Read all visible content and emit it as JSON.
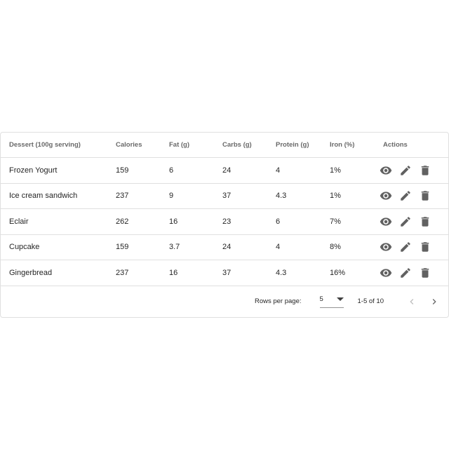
{
  "table": {
    "headers": [
      "Dessert (100g serving)",
      "Calories",
      "Fat (g)",
      "Carbs (g)",
      "Protein (g)",
      "Iron (%)",
      "Actions"
    ],
    "rows": [
      [
        "Frozen Yogurt",
        "159",
        "6",
        "24",
        "4",
        "1%"
      ],
      [
        "Ice cream sandwich",
        "237",
        "9",
        "37",
        "4.3",
        "1%"
      ],
      [
        "Eclair",
        "262",
        "16",
        "23",
        "6",
        "7%"
      ],
      [
        "Cupcake",
        "159",
        "3.7",
        "24",
        "4",
        "8%"
      ],
      [
        "Gingerbread",
        "237",
        "16",
        "37",
        "4.3",
        "16%"
      ]
    ],
    "row_action_icons": [
      "eye-icon",
      "pencil-icon",
      "trash-icon"
    ]
  },
  "pagination": {
    "rows_per_page_label": "Rows per page:",
    "rows_per_page_value": "5",
    "range_text": "1-5 of 10",
    "prev_icon": "chevron-left-icon",
    "next_icon": "chevron-right-icon"
  },
  "colors": {
    "icon": "#616161",
    "border": "#e0e0e0"
  }
}
